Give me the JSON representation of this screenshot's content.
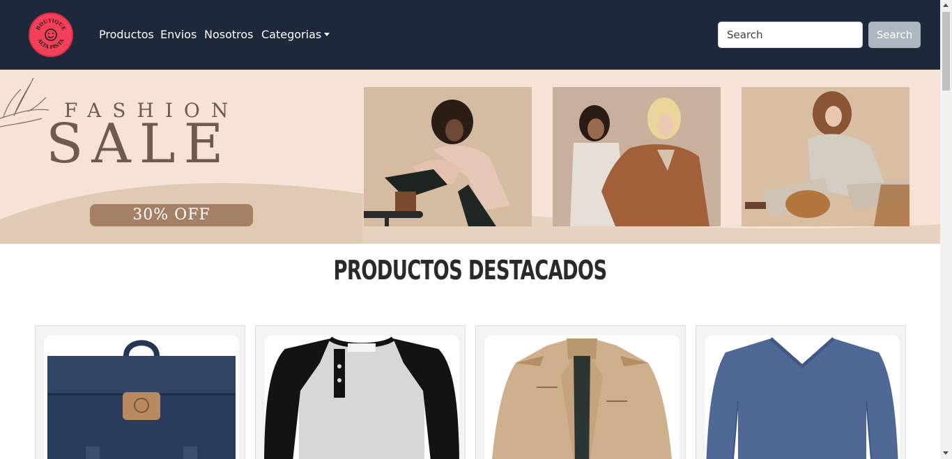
{
  "nav": {
    "logo_text_top": "BOUTIQUE",
    "logo_text_bottom": "ALTA PINTA",
    "links": [
      "Productos",
      "Envios",
      "Nosotros"
    ],
    "dropdown_label": "Categorias"
  },
  "search": {
    "placeholder": "Search",
    "button_label": "Search"
  },
  "banner": {
    "line1": "FASHION",
    "line2": "SALE",
    "discount": "30% OFF"
  },
  "featured": {
    "title": "PRODUCTOS DESTACADOS",
    "products": [
      {
        "image": "backpack-navy"
      },
      {
        "image": "henley-raglan-shirt"
      },
      {
        "image": "khaki-jacket"
      },
      {
        "image": "blue-vneck-longsleeve"
      }
    ]
  },
  "colors": {
    "navbar": "#1e283b",
    "logo": "#f2405a",
    "banner_bg": "#f6e3d7",
    "banner_text": "#6f5a4d",
    "discount_badge": "#a48066"
  }
}
